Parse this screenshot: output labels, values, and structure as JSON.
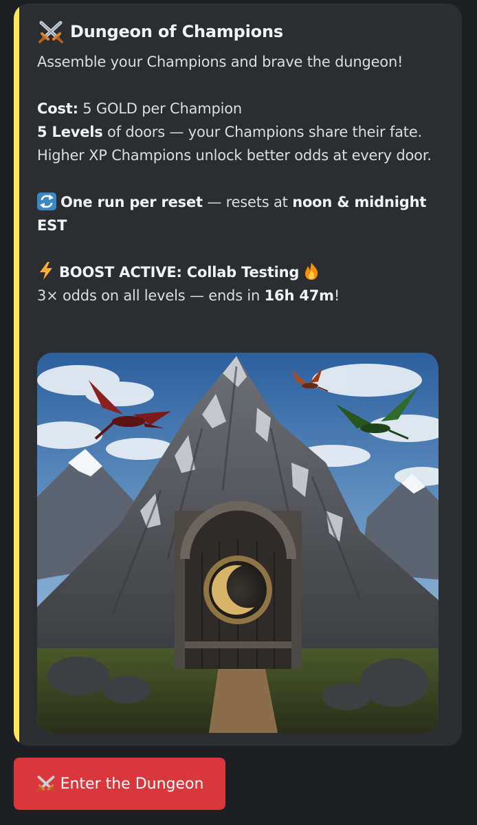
{
  "embed": {
    "accent_color": "#fee75c",
    "title_icon": "crossed-swords-icon",
    "title": "Dungeon of Champions",
    "intro": "Assemble your Champions and brave the dungeon!",
    "cost_label": "Cost:",
    "cost_text": " 5 GOLD per Champion",
    "levels_label": "5 Levels",
    "levels_text": " of doors — your Champions share their fate. Higher XP Champions unlock better odds at every door.",
    "reset_icon": "repeat-icon",
    "reset_label": "One run per reset",
    "reset_text": " — resets at ",
    "reset_time": "noon & midnight EST",
    "boost_icon": "lightning-icon",
    "boost_label": "BOOST ACTIVE: Collab Testing",
    "boost_end_icon": "fire-icon",
    "boost_text": "3× odds on all levels — ends in ",
    "boost_time": "16h 47m",
    "boost_suffix": "!",
    "image_icon": "dungeon-mountain-image"
  },
  "button": {
    "icon": "crossed-swords-icon",
    "label": "Enter the Dungeon",
    "color": "#da373c"
  }
}
